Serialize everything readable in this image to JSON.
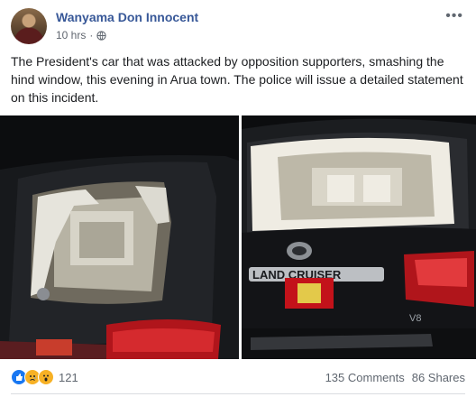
{
  "post": {
    "author": "Wanyama Don Innocent",
    "time": "10 hrs",
    "audience_icon": "globe-icon",
    "body": "The President's car that was attacked by opposition supporters, smashing the hind window, this evening in Arua town. The police will issue a detailed statement on this incident."
  },
  "photos": {
    "right_badge": "LAND CRUISER",
    "right_emblem": "V8"
  },
  "footer": {
    "reaction_icons": [
      "like-icon",
      "sad-icon",
      "wow-icon"
    ],
    "reaction_count": "121",
    "comments": "135 Comments",
    "shares": "86 Shares"
  },
  "colors": {
    "link": "#385898",
    "muted": "#606770",
    "like": "#1877f2",
    "emoji": "#f7b125",
    "taillight": "#b0151b"
  }
}
